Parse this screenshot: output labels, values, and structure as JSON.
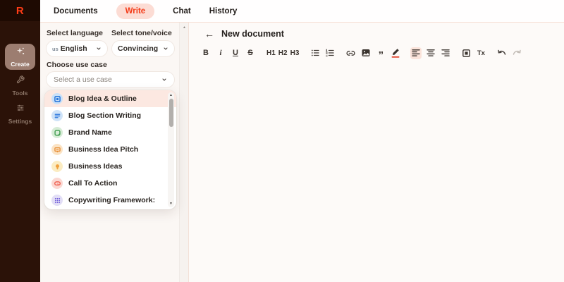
{
  "app": {
    "logo_letter": "R"
  },
  "colors": {
    "accent": "#f43b18",
    "accent_soft": "#fcdcd4",
    "sidebar_bg": "#2b1208",
    "row_highlight": "#fce8e1",
    "panel_bg": "#fbf7f4",
    "main_bg": "#fdfaf8"
  },
  "topnav": {
    "items": [
      {
        "label": "Documents",
        "active": false
      },
      {
        "label": "Write",
        "active": true
      },
      {
        "label": "Chat",
        "active": false
      },
      {
        "label": "History",
        "active": false
      }
    ]
  },
  "sidebar": {
    "items": [
      {
        "label": "Create",
        "icon": "sparkles-icon",
        "active": true
      },
      {
        "label": "Tools",
        "icon": "wrench-icon",
        "active": false
      },
      {
        "label": "Settings",
        "icon": "sliders-icon",
        "active": false
      }
    ]
  },
  "panel": {
    "language": {
      "label": "Select language",
      "flag": "us",
      "value": "English"
    },
    "tone": {
      "label": "Select tone/voice",
      "value": "Convincing"
    },
    "use_case": {
      "label": "Choose use case",
      "placeholder": "Select a use case"
    },
    "dropdown": {
      "items": [
        {
          "label": "Blog Idea & Outline",
          "icon": "blog-idea-icon",
          "active": true
        },
        {
          "label": "Blog Section Writing",
          "icon": "blog-section-icon",
          "active": false
        },
        {
          "label": "Brand Name",
          "icon": "brand-name-icon",
          "active": false
        },
        {
          "label": "Business Idea Pitch",
          "icon": "business-pitch-icon",
          "active": false
        },
        {
          "label": "Business Ideas",
          "icon": "business-ideas-icon",
          "active": false
        },
        {
          "label": "Call To Action",
          "icon": "call-to-action-icon",
          "active": false
        },
        {
          "label": "Copywriting Framework:",
          "icon": "copywriting-framework-icon",
          "active": false
        }
      ]
    }
  },
  "editor": {
    "back_arrow": "←",
    "title": "New document",
    "toolbar": {
      "bold": "B",
      "italic": "i",
      "underline": "U",
      "strike": "S",
      "h1": "H1",
      "h2": "H2",
      "h3": "H3",
      "quote": "”",
      "clear_format": "Tx"
    }
  }
}
